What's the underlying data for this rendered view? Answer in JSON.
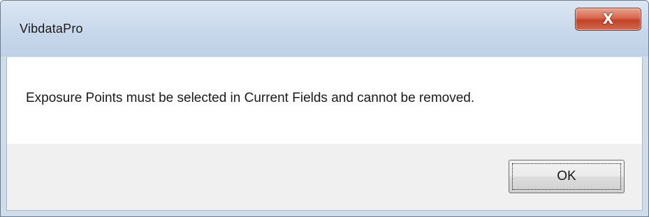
{
  "window": {
    "title": "VibdataPro",
    "close_icon": "close-icon",
    "close_glyph": "X"
  },
  "content": {
    "message": "Exposure Points must be selected in Current Fields and cannot be removed."
  },
  "footer": {
    "ok_label": "OK"
  },
  "colors": {
    "title_bar": "#c7d7eb",
    "close_button": "#c24329",
    "content_bg": "#ffffff",
    "footer_bg": "#f0f0f0"
  }
}
